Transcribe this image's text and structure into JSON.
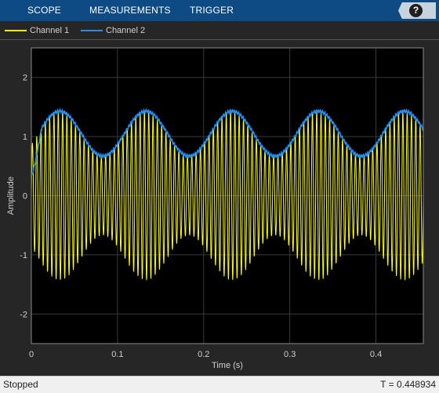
{
  "toolstrip": {
    "tabs": [
      {
        "label": "SCOPE"
      },
      {
        "label": "MEASUREMENTS"
      },
      {
        "label": "TRIGGER"
      }
    ],
    "help_icon": "?"
  },
  "legend": {
    "items": [
      {
        "label": "Channel 1",
        "color": "#ffff00"
      },
      {
        "label": "Channel 2",
        "color": "#1e90ff"
      }
    ]
  },
  "colors": {
    "toolstrip_bg": "#0e4a84",
    "plot_bg": "#000000",
    "figure_bg": "#262626",
    "channel1": "#ffff00",
    "channel2": "#1e90ff"
  },
  "chart_data": {
    "type": "line",
    "xlabel": "Time (s)",
    "ylabel": "Amplitude",
    "xlim": [
      0,
      0.455
    ],
    "ylim": [
      -2.5,
      2.5
    ],
    "grid": true,
    "legend_placement": "top-left, above plot",
    "xticks": [
      0,
      0.1,
      0.2,
      0.3,
      0.4
    ],
    "xtick_labels": [
      "0",
      "0.1",
      "0.2",
      "0.3",
      "0.4"
    ],
    "yticks": [
      -2,
      -1,
      0,
      1,
      2
    ],
    "ytick_labels": [
      "-2",
      "-1",
      "0",
      "1",
      "2"
    ],
    "series": [
      {
        "name": "Channel 1",
        "color": "#ffff00",
        "description": "amplitude-modulated sinusoid",
        "carrier_hz": 200,
        "envelope_mean": 1.05,
        "envelope_amplitude": 0.38,
        "envelope_hz": 10,
        "envelope_peak_time": 0.033
      },
      {
        "name": "Channel 2",
        "color": "#1e90ff",
        "description": "envelope of Channel 1",
        "mean": 1.05,
        "amplitude": 0.38,
        "frequency_hz": 10,
        "peak_time": 0.033
      }
    ]
  },
  "status": {
    "state": "Stopped",
    "time": "T = 0.448934"
  }
}
